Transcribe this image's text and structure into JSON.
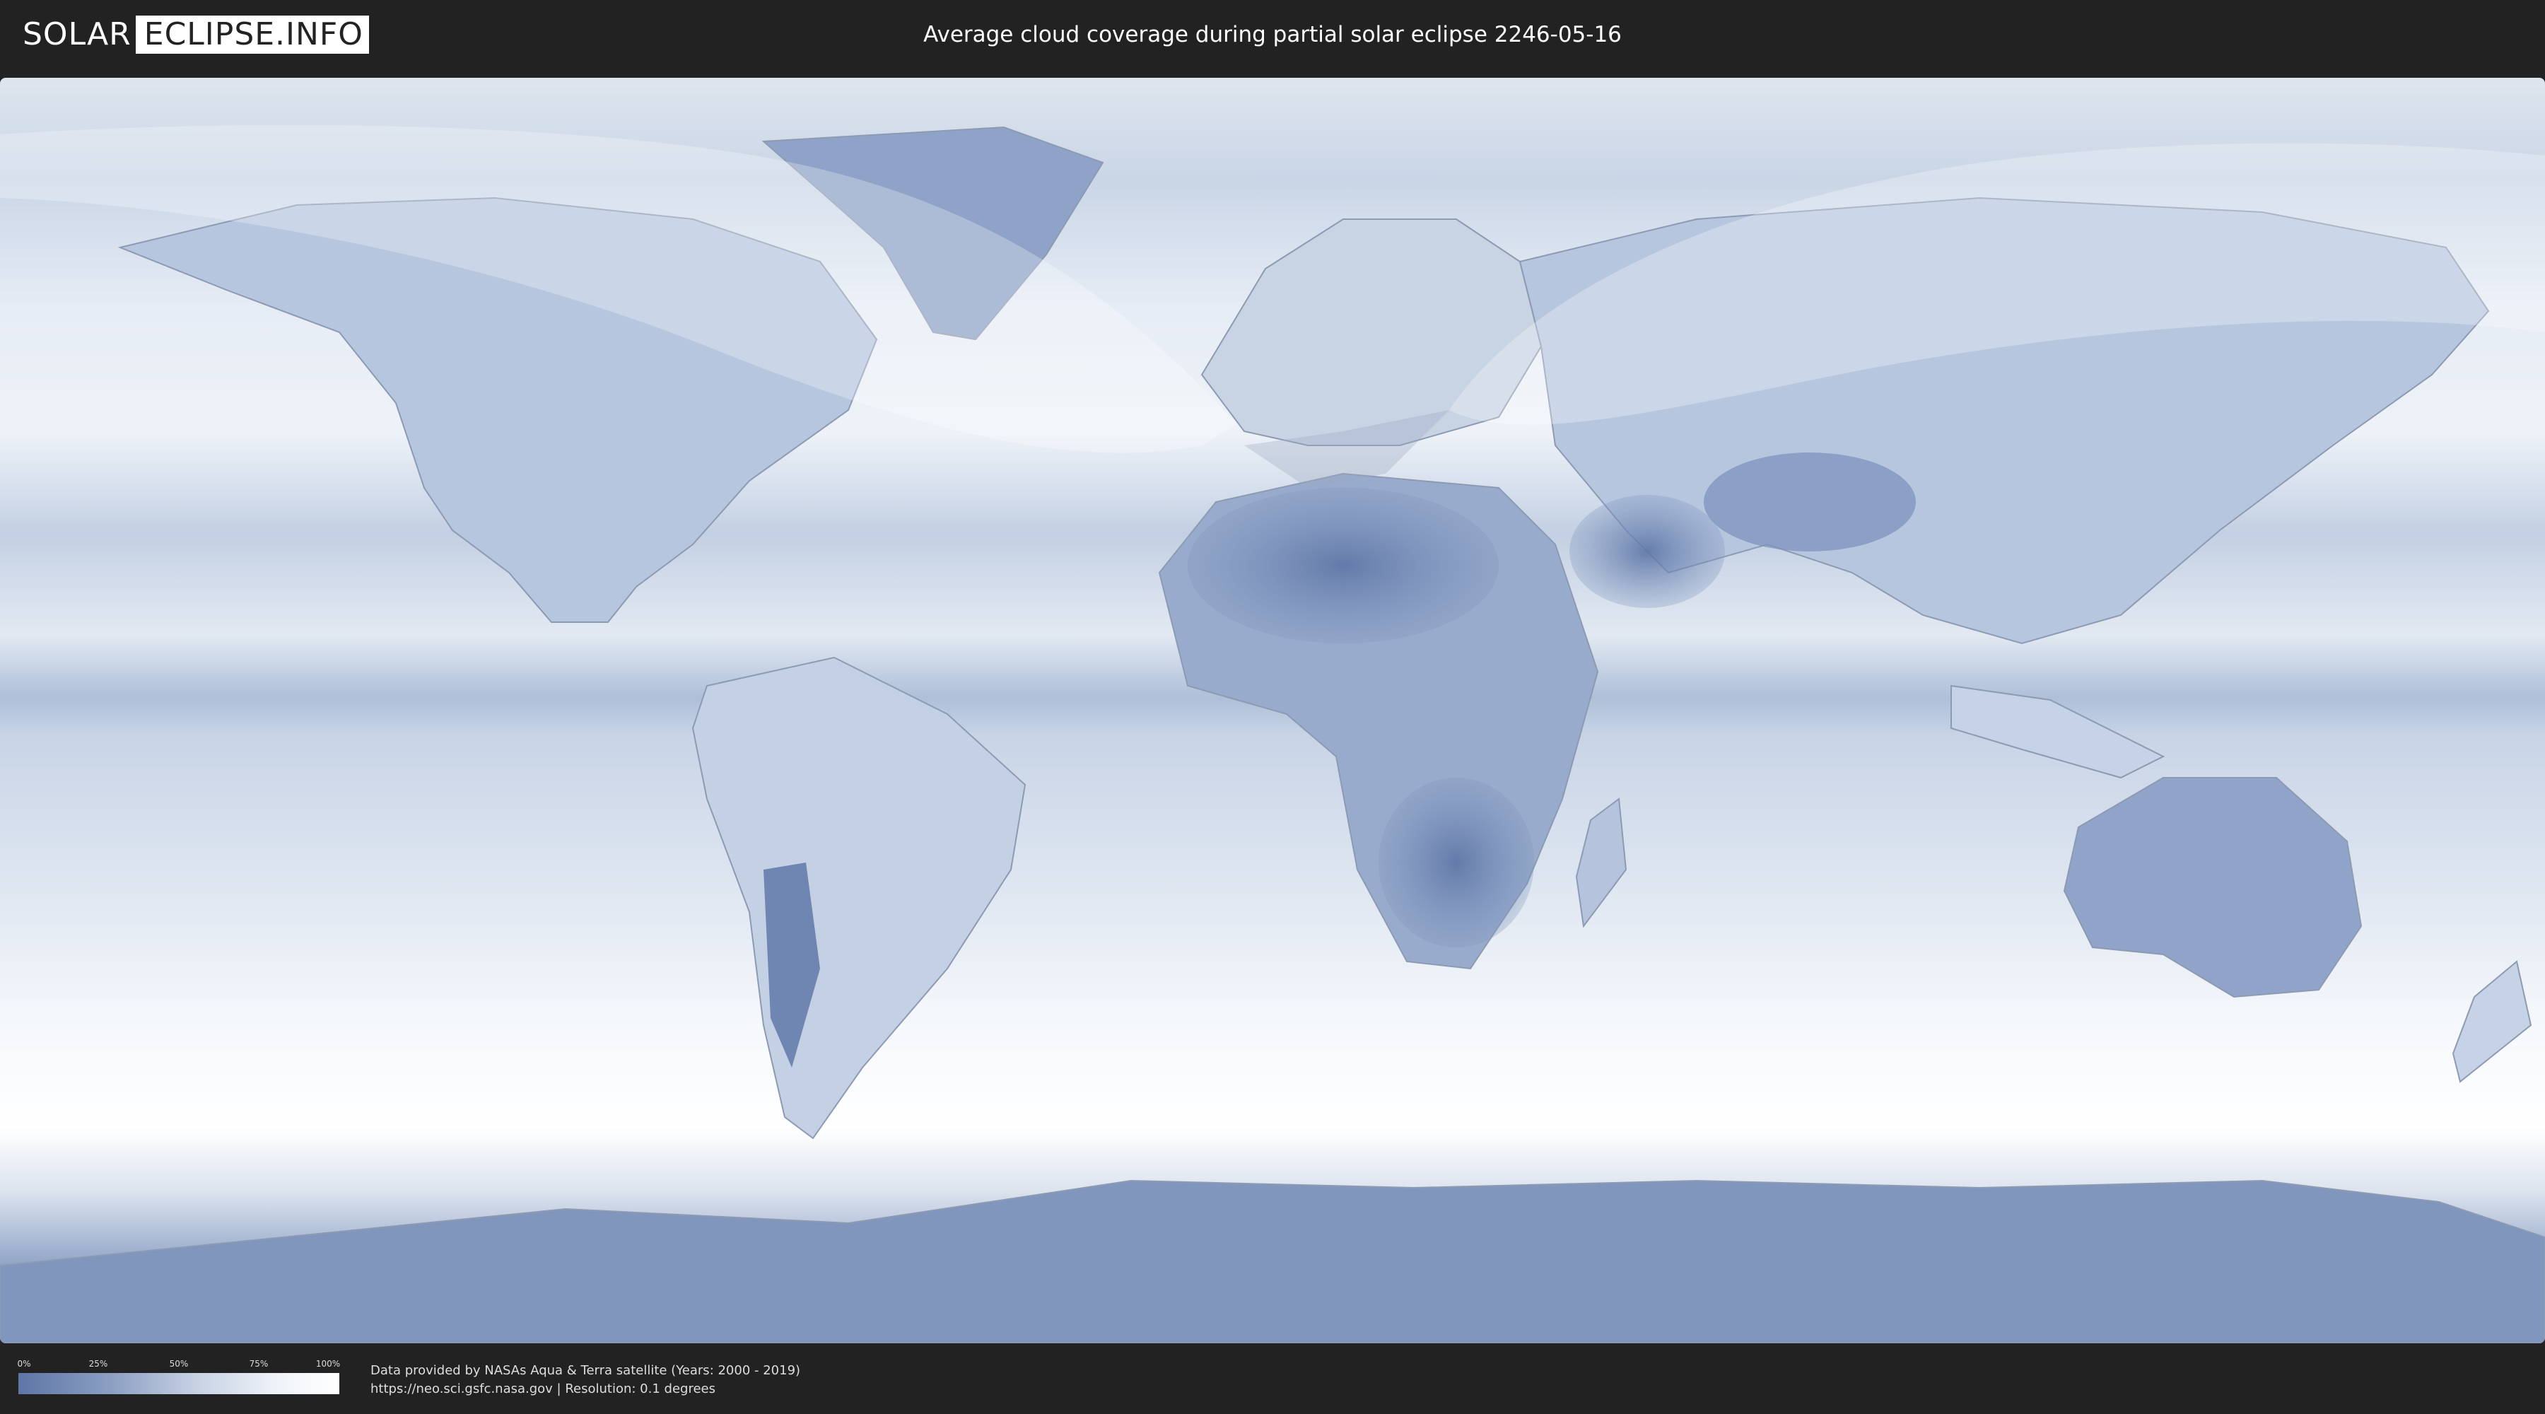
{
  "header": {
    "logo_left": "SOLAR",
    "logo_right": "ECLIPSE.INFO",
    "title": "Average cloud coverage during partial solar eclipse 2246-05-16"
  },
  "colors": {
    "background": "#222222",
    "cloud_low": "#5e76a6",
    "cloud_high": "#ffffff",
    "eclipse_overlay": "#ffffff"
  },
  "legend": {
    "ticks": [
      "0%",
      "25%",
      "50%",
      "75%",
      "100%"
    ]
  },
  "credits": {
    "line1": "Data provided by NASAs Aqua & Terra satellite (Years: 2000 - 2019)",
    "line2": "https://neo.sci.gsfc.nasa.gov | Resolution: 0.1 degrees"
  },
  "map": {
    "projection": "equirectangular",
    "layer": "cloud-coverage",
    "overlay": "partial-eclipse-visibility-zone"
  }
}
